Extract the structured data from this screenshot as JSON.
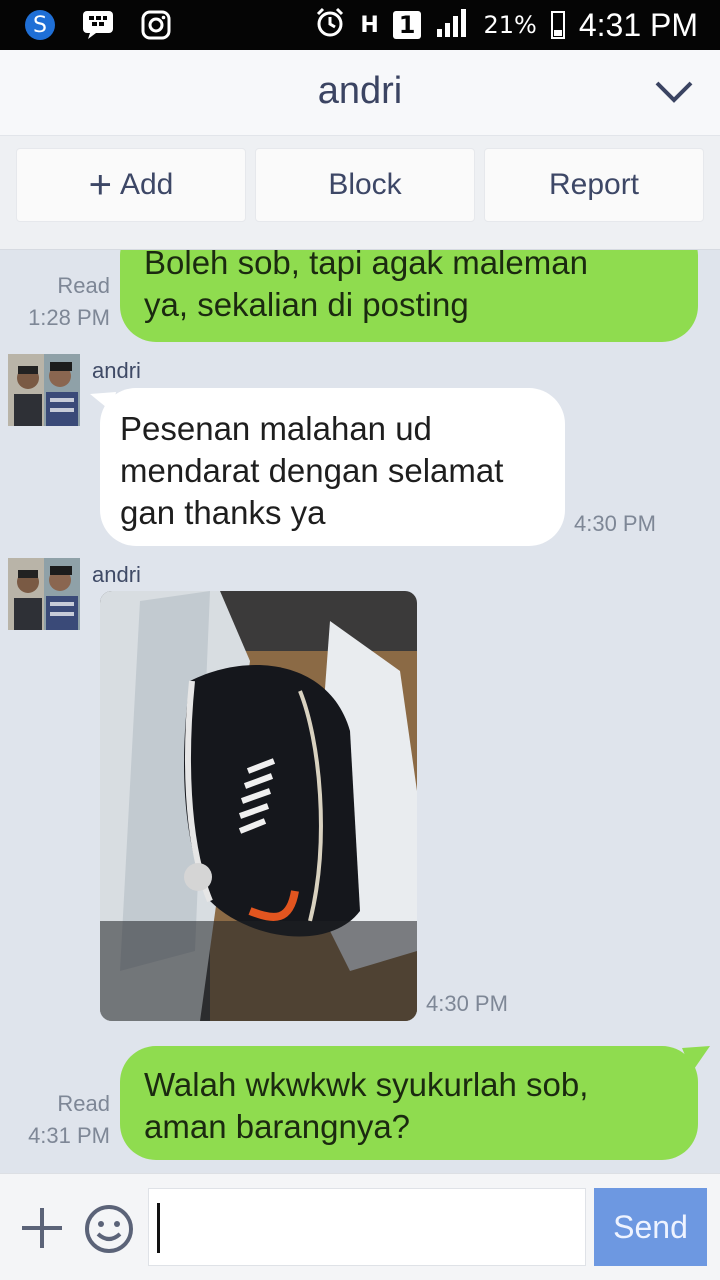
{
  "status_bar": {
    "time": "4:31 PM",
    "battery": "21%",
    "network": "H",
    "sim": "1"
  },
  "header": {
    "title": "andri"
  },
  "actions": {
    "add": "Add",
    "block": "Block",
    "report": "Report"
  },
  "messages": [
    {
      "side": "me",
      "text": "Boleh sob, tapi agak maleman\nya, sekalian di posting",
      "read": "Read",
      "time": "1:28 PM"
    },
    {
      "side": "them",
      "sender": "andri",
      "text": "Pesenan malahan ud\nmendarat dengan selamat\ngan thanks ya",
      "time": "4:30 PM"
    },
    {
      "side": "them",
      "sender": "andri",
      "type": "image",
      "time": "4:30 PM"
    },
    {
      "side": "me",
      "text": "Walah wkwkwk syukurlah sob,\naman barangnya?",
      "read": "Read",
      "time": "4:31 PM"
    }
  ],
  "input": {
    "placeholder": "",
    "send_label": "Send"
  }
}
